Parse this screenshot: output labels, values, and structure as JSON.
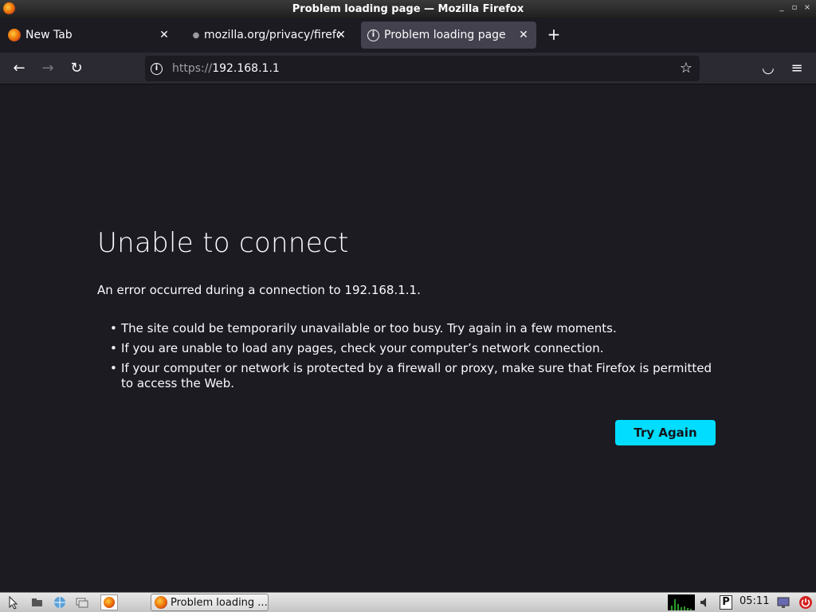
{
  "window": {
    "title": "Problem loading page — Mozilla Firefox",
    "controls": [
      "_",
      "▫",
      "×"
    ]
  },
  "tabs": [
    {
      "label": "New Tab",
      "icon": "firefox-icon",
      "active": false
    },
    {
      "label": "mozilla.org/privacy/firefo",
      "icon": "dot-icon",
      "active": false
    },
    {
      "label": "Problem loading page",
      "icon": "info-icon",
      "active": true
    }
  ],
  "toolbar": {
    "back": "←",
    "forward": "→",
    "reload": "↻",
    "new_tab": "+",
    "star": "☆",
    "pocket": "◡",
    "menu": "≡"
  },
  "urlbar": {
    "scheme": "https://",
    "host": "192.168.1.1"
  },
  "error_page": {
    "title": "Unable to connect",
    "description": "An error occurred during a connection to 192.168.1.1.",
    "items": [
      "The site could be temporarily unavailable or too busy. Try again in a few moments.",
      "If you are unable to load any pages, check your computer’s network connection.",
      "If your computer or network is protected by a firewall or proxy, make sure that Firefox is permitted to access the Web."
    ],
    "button": "Try Again"
  },
  "taskbar": {
    "task_label": "Problem loading ...",
    "clock": "05:11",
    "tray_letter": "P"
  },
  "colors": {
    "accent": "#00ddff",
    "page_bg": "#1c1b22",
    "toolbar_bg": "#2b2a33",
    "active_tab": "#42414d"
  }
}
